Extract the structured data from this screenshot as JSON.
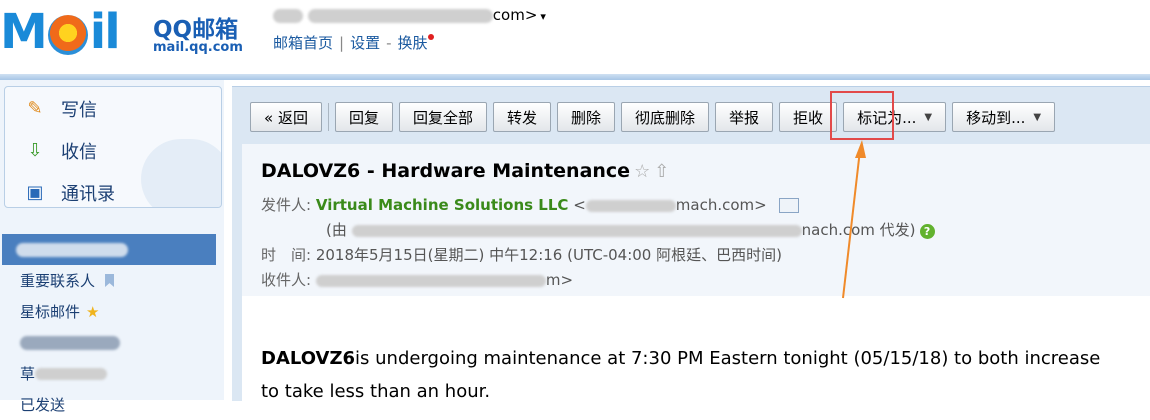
{
  "header": {
    "logo_text": "MOil",
    "brand": "QQ邮箱",
    "url": "mail.qq.com",
    "account_suffix": "com>",
    "links": {
      "home": "邮箱首页",
      "sep1": "|",
      "settings": "设置",
      "sep2": "-",
      "skin": "换肤"
    }
  },
  "sidebar": {
    "compose": "写信",
    "inbox": "收信",
    "contacts": "通讯录",
    "folders": [
      {
        "label": "",
        "active": true
      },
      {
        "label": "重要联系人"
      },
      {
        "label": "星标邮件"
      },
      {
        "label": ""
      },
      {
        "label": "草"
      },
      {
        "label": "已发送"
      }
    ]
  },
  "toolbar": {
    "back": "« 返回",
    "reply": "回复",
    "reply_all": "回复全部",
    "forward": "转发",
    "delete": "删除",
    "delete_forever": "彻底删除",
    "report": "举报",
    "reject": "拒收",
    "mark_as": "标记为...",
    "move_to": "移动到..."
  },
  "message": {
    "subject": "DALOVZ6 - Hardware Maintenance",
    "from_label": "发件人:",
    "sender_name": "Virtual Machine Solutions LLC",
    "sender_email_visible": "mach.com>",
    "on_behalf_prefix": "(由",
    "on_behalf_suffix": "nach.com 代发)",
    "time_label": "时　间:",
    "time_value": "2018年5月15日(星期二) 中午12:16 (UTC-04:00 阿根廷、巴西时间)",
    "to_label": "收件人:",
    "to_visible": "m>",
    "body_bold": "DALOVZ6",
    "body_line1": "is undergoing maintenance at 7:30 PM Eastern tonight (05/15/18) to both increase",
    "body_line2": "to take less than an hour."
  }
}
